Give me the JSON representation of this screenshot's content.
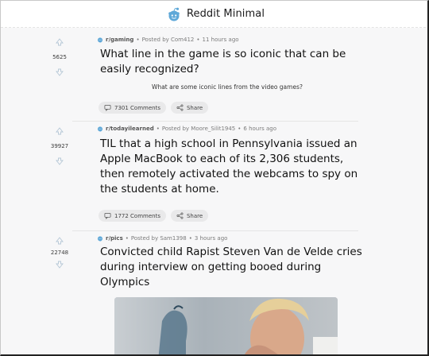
{
  "app": {
    "title": "Reddit Minimal"
  },
  "posts": [
    {
      "subreddit": "r/gaming",
      "posted_by": "Posted by Com412",
      "time": "11 hours ago",
      "score": "5625",
      "title": "What line in the game is so iconic that can be easily recognized?",
      "selftext": "What are some iconic lines from the video games?",
      "comments": "7301 Comments",
      "share": "Share"
    },
    {
      "subreddit": "r/todayilearned",
      "posted_by": "Posted by Moore_Silit1945",
      "time": "6 hours ago",
      "score": "39927",
      "title": "TIL that a high school in Pennsylvania issued an Apple MacBook to each of its 2,306 students, then remotely activated the webcams to spy on the students at home.",
      "comments": "1772 Comments",
      "share": "Share"
    },
    {
      "subreddit": "r/pics",
      "posted_by": "Posted by Sam1398",
      "time": "3 hours ago",
      "score": "22748",
      "title": "Convicted child Rapist Steven Van de Velde cries during interview on getting booed during Olympics"
    }
  ],
  "separator": "•"
}
